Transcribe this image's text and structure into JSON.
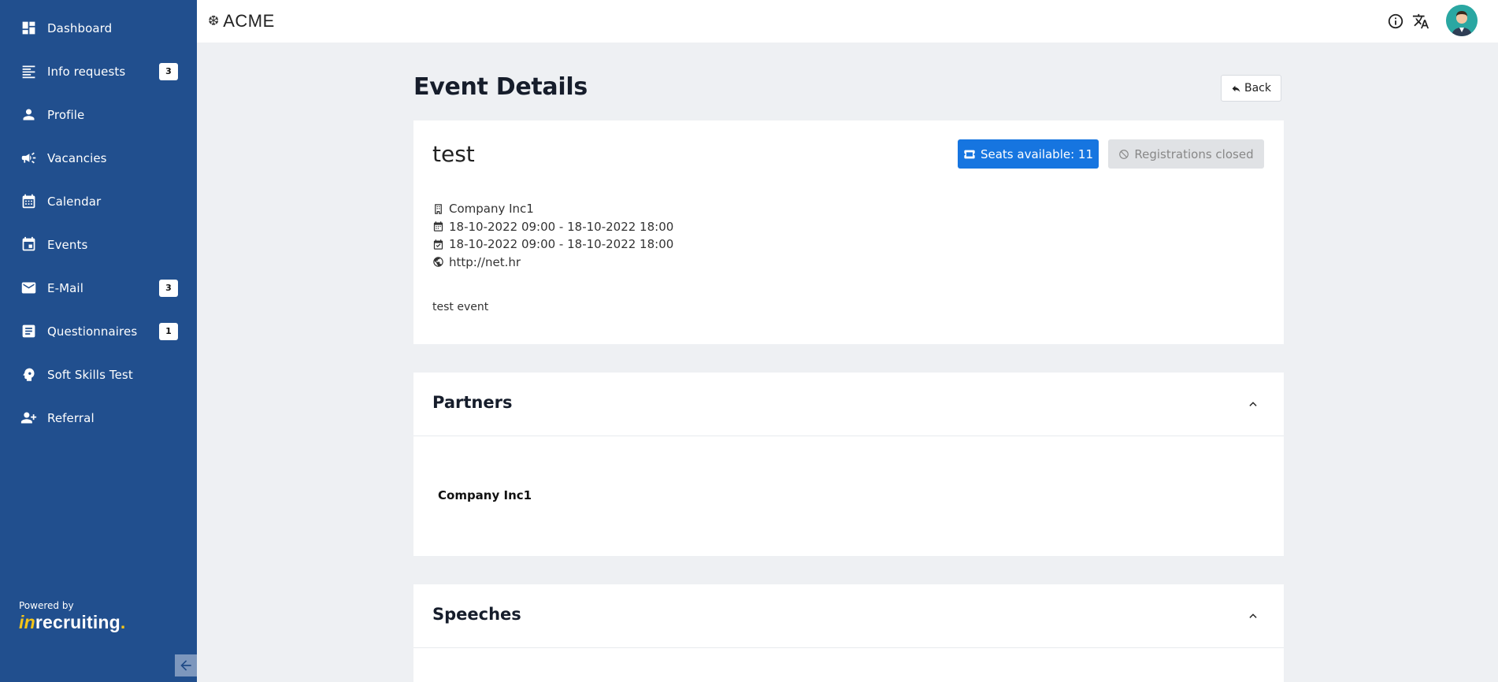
{
  "sidebar": {
    "items": [
      {
        "label": "Dashboard",
        "icon": "dashboard-icon",
        "badge": ""
      },
      {
        "label": "Info requests",
        "icon": "list-icon",
        "badge": "3"
      },
      {
        "label": "Profile",
        "icon": "person-icon",
        "badge": ""
      },
      {
        "label": "Vacancies",
        "icon": "megaphone-icon",
        "badge": ""
      },
      {
        "label": "Calendar",
        "icon": "calendar-grid-icon",
        "badge": ""
      },
      {
        "label": "Events",
        "icon": "event-icon",
        "badge": ""
      },
      {
        "label": "E-Mail",
        "icon": "mail-icon",
        "badge": "3"
      },
      {
        "label": "Questionnaires",
        "icon": "document-icon",
        "badge": "1"
      },
      {
        "label": "Soft Skills Test",
        "icon": "head-gear-icon",
        "badge": ""
      },
      {
        "label": "Referral",
        "icon": "add-user-icon",
        "badge": ""
      }
    ],
    "powered_by": "Powered by",
    "brand_in": "in",
    "brand_rest": "recruiting",
    "brand_dot": "."
  },
  "topbar": {
    "logo_text": "ACME"
  },
  "page": {
    "title": "Event Details",
    "back_label": "Back"
  },
  "event": {
    "name": "test",
    "seats_label": "Seats available: 11",
    "registrations_label": "Registrations closed",
    "company": "Company Inc1",
    "event_time": "18-10-2022 09:00 - 18-10-2022 18:00",
    "registration_time": "18-10-2022 09:00 - 18-10-2022 18:00",
    "website": "http://net.hr",
    "description": "test event"
  },
  "partners": {
    "title": "Partners",
    "items": [
      "Company Inc1"
    ]
  },
  "speeches": {
    "title": "Speeches"
  },
  "colors": {
    "sidebar": "#214f8e",
    "primary_button": "#1675e0",
    "background": "#eef0f3",
    "brand_accent": "#f5c518"
  }
}
